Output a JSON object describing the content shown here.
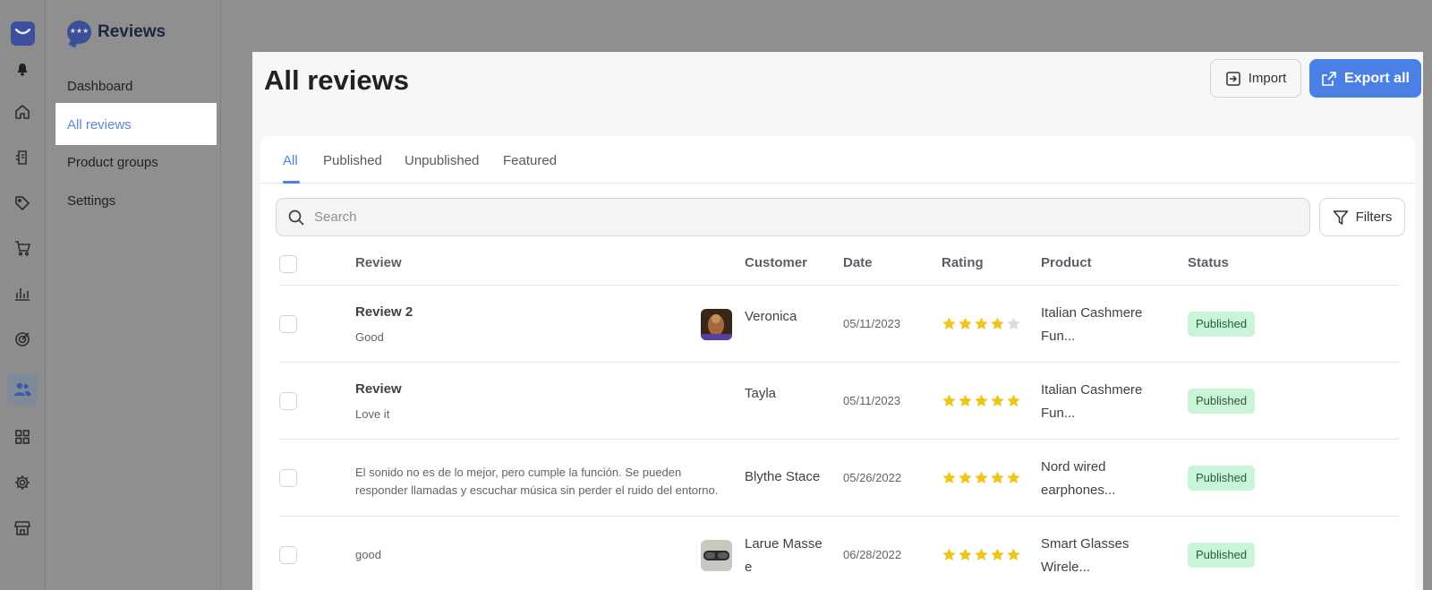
{
  "app": {
    "brand": "Reviews"
  },
  "nav": {
    "items": [
      {
        "label": "Dashboard"
      },
      {
        "label": "All reviews"
      },
      {
        "label": "Product groups"
      },
      {
        "label": "Settings"
      }
    ]
  },
  "page": {
    "title": "All reviews",
    "import_label": "Import",
    "export_label": "Export all"
  },
  "tabs": [
    {
      "label": "All",
      "active": true
    },
    {
      "label": "Published"
    },
    {
      "label": "Unpublished"
    },
    {
      "label": "Featured"
    }
  ],
  "search": {
    "placeholder": "Search"
  },
  "filters_label": "Filters",
  "table": {
    "headers": [
      "Review",
      "Customer",
      "Date",
      "Rating",
      "Product",
      "Status"
    ],
    "rows": [
      {
        "title": "Review 2",
        "body": "Good",
        "customer": "Veronica",
        "date": "05/11/2023",
        "rating": 4,
        "product_line1": "Italian Cashmere",
        "product_line2": "Fun...",
        "status": "Published",
        "thumb": "photo"
      },
      {
        "title": "Review",
        "body": "Love it",
        "customer": "Tayla",
        "date": "05/11/2023",
        "rating": 5,
        "product_line1": "Italian Cashmere",
        "product_line2": "Fun...",
        "status": "Published"
      },
      {
        "body": "El sonido no es de lo mejor, pero cumple la función. Se pueden responder llamadas y escuchar música sin perder el ruido del entorno.",
        "customer": "Blythe Stace",
        "date": "05/26/2022",
        "rating": 5,
        "product_line1": "Nord wired",
        "product_line2": "earphones...",
        "status": "Published"
      },
      {
        "body": "good",
        "customer_line1": "Larue Masse",
        "customer_line2": "e",
        "date": "06/28/2022",
        "rating": 5,
        "product_line1": "Smart Glasses",
        "product_line2": "Wirele...",
        "status": "Published",
        "thumb": "photo"
      }
    ]
  },
  "colors": {
    "accent": "#4b7fe0",
    "star": "#f0c419",
    "star_empty": "#dcdcdc",
    "badge_bg": "#c8f5d8"
  }
}
